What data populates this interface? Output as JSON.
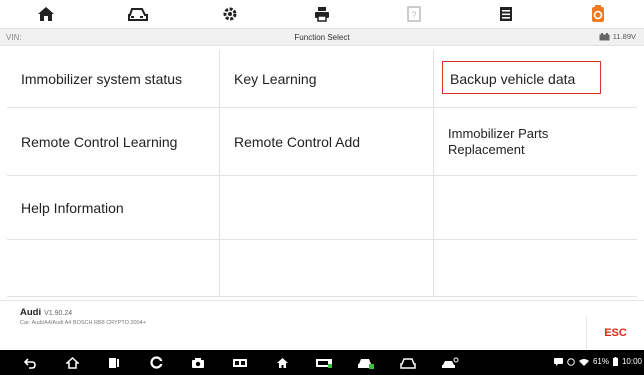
{
  "toolbar": {
    "icons": [
      "home-icon",
      "vehicle-icon",
      "settings-icon",
      "print-icon",
      "help-icon",
      "datalog-icon",
      "logo-icon"
    ],
    "accent_active": "#f07a1f"
  },
  "titlebar": {
    "vin_label": "VIN:",
    "title": "Function Select",
    "voltage": "11.89V"
  },
  "functions": [
    {
      "label": "Immobilizer system status"
    },
    {
      "label": "Key Learning"
    },
    {
      "label": "Backup vehicle data",
      "selected": true
    },
    {
      "label": "Remote Control Learning"
    },
    {
      "label": "Remote Control Add"
    },
    {
      "label": "Immobilizer Parts Replacement"
    },
    {
      "label": "Help Information"
    },
    {
      "label": ""
    },
    {
      "label": ""
    },
    {
      "label": ""
    },
    {
      "label": ""
    },
    {
      "label": ""
    }
  ],
  "footer": {
    "make": "Audi",
    "version": "V1.90.24",
    "car_path": "Car: Audi/A4/Audi A4 BOSCH RB8 CRYPTO 2004+",
    "esc_label": "ESC"
  },
  "navbar": {
    "battery": "61%",
    "clock": "10:00"
  },
  "colors": {
    "selection_border": "#d9342b",
    "esc": "#e0271b",
    "grid_line": "#e2e2e2"
  }
}
